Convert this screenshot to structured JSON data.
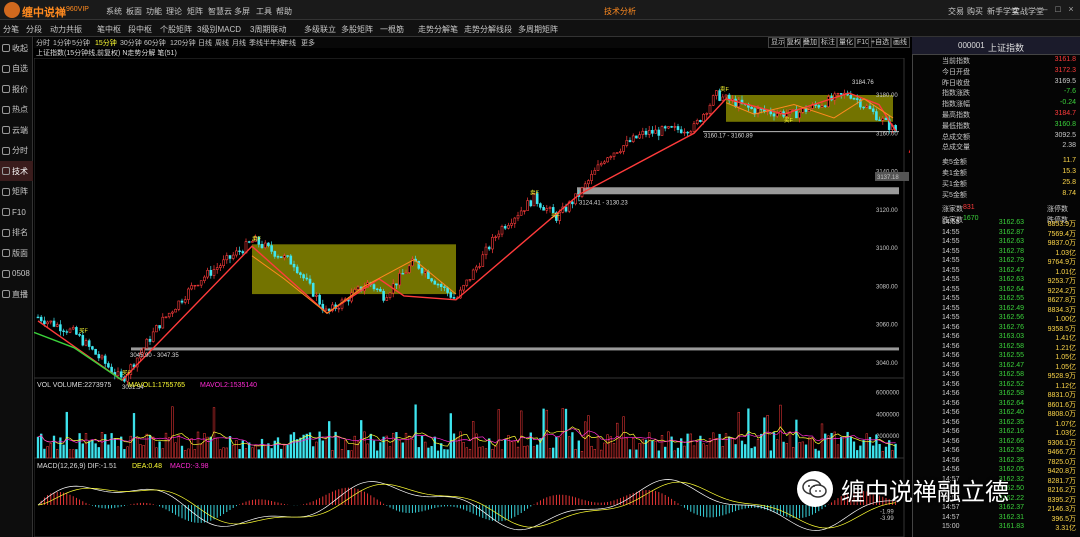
{
  "app": {
    "name": "缠中说禅",
    "version": "960VIP",
    "window_title": "技术分析"
  },
  "top_menu": [
    "系统",
    "板面",
    "功能",
    "理论",
    "矩阵",
    "智慧云",
    "多屏",
    "工具",
    "帮助"
  ],
  "right_menu": [
    "交易",
    "购买",
    "新手学堂",
    "实战学堂"
  ],
  "toolbar2": [
    "分笔",
    "分段",
    "动力共振",
    "笔中枢",
    "段中枢",
    "个股矩阵",
    "3级别MACD",
    "3周期联动",
    "多级联立",
    "多股矩阵",
    "一根筋",
    "走势分解笔",
    "走势分解线段",
    "多周期矩阵"
  ],
  "sidebar": [
    "收起",
    "自选",
    "报价",
    "热点",
    "云端",
    "分时",
    "技术",
    "矩阵",
    "F10",
    "排名",
    "版面",
    "0508",
    "直播"
  ],
  "sidebar_active": 6,
  "periods": [
    "分时",
    "1分钟",
    "5分钟",
    "15分钟",
    "30分钟",
    "60分钟",
    "120分钟",
    "日线",
    "周线",
    "月线",
    "季线",
    "半年线",
    "年线",
    "更多"
  ],
  "period_active": 3,
  "right_tools": [
    "显示",
    "复权",
    "叠加",
    "标注",
    "量化",
    "F10",
    "+自选",
    "画线"
  ],
  "chart_header": "上证指数(15分钟线,前复权) N走势分解 笔(51)",
  "price_axis": [
    "3180.00",
    "3160.00",
    "3140.00",
    "3120.00",
    "3100.00",
    "3080.00",
    "3060.00",
    "3040.00"
  ],
  "price_marker": "3137.18",
  "annotations": {
    "low1": "3031.54",
    "range1": "3045.90 - 3047.35",
    "range2": "3124.41 - 3130.23",
    "range3": "3160.17 - 3160.89",
    "high": "3184.76",
    "buy_label": "买F",
    "sell_label": "卖F"
  },
  "vol_header": {
    "label": "VOL VOLUME:2273975",
    "mavol1": "MAVOL1:1755765",
    "mavol2": "MAVOL2:1535140"
  },
  "vol_axis": [
    "6000000",
    "4000000",
    "2000000"
  ],
  "macd_header": {
    "label": "MACD(12,26,9) DIF:-1.51",
    "dea": "DEA:0.48",
    "macd": "MACD:-3.98"
  },
  "macd_axis": [
    "-1.99",
    "-3.99"
  ],
  "quote": {
    "code": "000001",
    "name": "上证指数",
    "rows": [
      {
        "label": "当前指数",
        "value": "3161.8",
        "color": "red"
      },
      {
        "label": "今日开盘",
        "value": "3172.3",
        "color": "red"
      },
      {
        "label": "昨日收盘",
        "value": "3169.5",
        "color": "white"
      },
      {
        "label": "指数涨跌",
        "value": "-7.6",
        "color": "green"
      },
      {
        "label": "指数涨幅",
        "value": "-0.24",
        "color": "green"
      },
      {
        "label": "最高指数",
        "value": "3184.7",
        "color": "red"
      },
      {
        "label": "最低指数",
        "value": "3160.8",
        "color": "green"
      },
      {
        "label": "总成交额",
        "value": "3092.5",
        "color": "white"
      },
      {
        "label": "总成交量",
        "value": "2.38",
        "color": "white"
      },
      {
        "label": "卖5金额",
        "value": "11.7",
        "color": "yel"
      },
      {
        "label": "卖1金额",
        "value": "15.3",
        "color": "yel"
      },
      {
        "label": "买1金额",
        "value": "25.8",
        "color": "yel"
      },
      {
        "label": "买5金额",
        "value": "8.74",
        "color": "yel"
      },
      {
        "label": "涨家数",
        "value": "831",
        "extra_label": "涨停数",
        "color": "red"
      },
      {
        "label": "跌家数",
        "value": "1670",
        "extra_label": "跌停数",
        "color": "green"
      }
    ]
  },
  "ticks": [
    [
      "14:55",
      "3162.63",
      "8853.9万"
    ],
    [
      "14:55",
      "3162.87",
      "7569.4万"
    ],
    [
      "14:55",
      "3162.63",
      "9837.0万"
    ],
    [
      "14:55",
      "3162.78",
      "1.03亿"
    ],
    [
      "14:55",
      "3162.79",
      "9764.9万"
    ],
    [
      "14:55",
      "3162.47",
      "1.01亿"
    ],
    [
      "14:55",
      "3162.63",
      "9253.7万"
    ],
    [
      "14:55",
      "3162.64",
      "9224.2万"
    ],
    [
      "14:55",
      "3162.55",
      "8627.8万"
    ],
    [
      "14:55",
      "3162.49",
      "8834.3万"
    ],
    [
      "14:55",
      "3162.56",
      "1.00亿"
    ],
    [
      "14:56",
      "3162.76",
      "9358.5万"
    ],
    [
      "14:56",
      "3163.03",
      "1.41亿"
    ],
    [
      "14:56",
      "3162.58",
      "1.21亿"
    ],
    [
      "14:56",
      "3162.55",
      "1.05亿"
    ],
    [
      "14:56",
      "3162.47",
      "1.05亿"
    ],
    [
      "14:56",
      "3162.58",
      "9528.9万"
    ],
    [
      "14:56",
      "3162.52",
      "1.12亿"
    ],
    [
      "14:56",
      "3162.58",
      "8831.0万"
    ],
    [
      "14:56",
      "3162.64",
      "8601.6万"
    ],
    [
      "14:56",
      "3162.40",
      "8808.0万"
    ],
    [
      "14:56",
      "3162.35",
      "1.07亿"
    ],
    [
      "14:56",
      "3162.16",
      "1.03亿"
    ],
    [
      "14:56",
      "3162.66",
      "9306.1万"
    ],
    [
      "14:56",
      "3162.58",
      "9466.7万"
    ],
    [
      "14:56",
      "3162.35",
      "7825.0万"
    ],
    [
      "14:56",
      "3162.05",
      "9420.8万"
    ],
    [
      "14:57",
      "3162.32",
      "8281.7万"
    ],
    [
      "14:57",
      "3162.50",
      "8216.2万"
    ],
    [
      "14:57",
      "3162.22",
      "8395.2万"
    ],
    [
      "14:57",
      "3162.37",
      "2146.3万"
    ],
    [
      "14:57",
      "3162.31",
      "396.5万"
    ],
    [
      "15:00",
      "3161.83",
      "3.31亿"
    ]
  ],
  "watermark": "缠中说禅融立德",
  "colors": {
    "up": "#ff3b3b",
    "down": "#3ee6f0",
    "pivot_fill": "#9a9a00",
    "orange": "#ff8a1f"
  }
}
